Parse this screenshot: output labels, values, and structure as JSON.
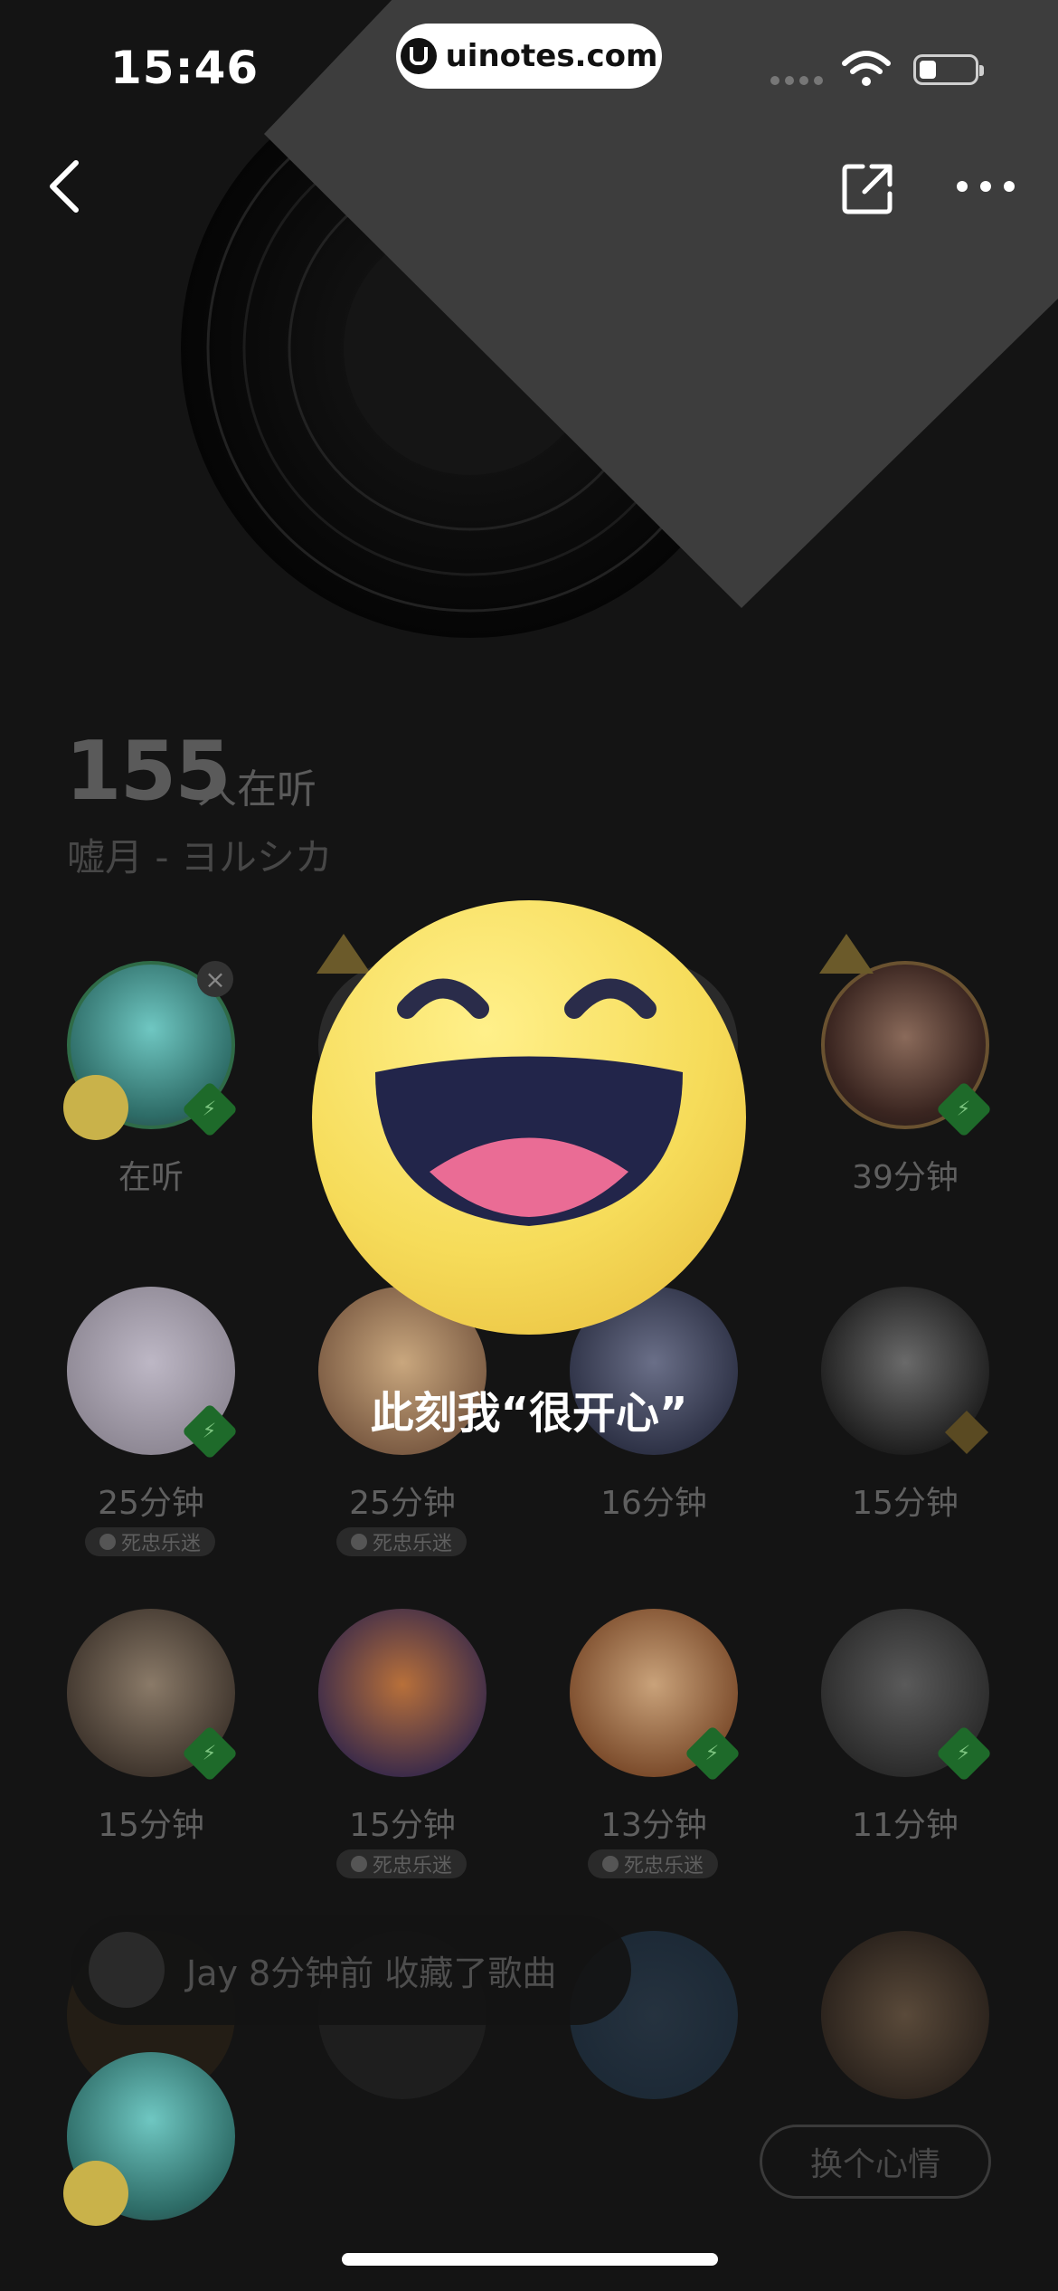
{
  "status_bar": {
    "time": "15:46",
    "url": "uinotes.com"
  },
  "header": {
    "listener_count": "155",
    "listener_unit": "人在听",
    "song_line": "嘘月 - ヨルシカ"
  },
  "grid": {
    "rows": [
      {
        "cells": [
          {
            "label": "在听",
            "badge": ""
          },
          {
            "label": "",
            "badge": ""
          },
          {
            "label": "",
            "badge": ""
          },
          {
            "label": "39分钟",
            "badge": ""
          }
        ]
      },
      {
        "cells": [
          {
            "label": "25分钟",
            "badge": "死忠乐迷"
          },
          {
            "label": "25分钟",
            "badge": "死忠乐迷"
          },
          {
            "label": "16分钟",
            "badge": ""
          },
          {
            "label": "15分钟",
            "badge": ""
          }
        ]
      },
      {
        "cells": [
          {
            "label": "15分钟",
            "badge": ""
          },
          {
            "label": "15分钟",
            "badge": "死忠乐迷"
          },
          {
            "label": "13分钟",
            "badge": "死忠乐迷"
          },
          {
            "label": "11分钟",
            "badge": ""
          }
        ]
      }
    ]
  },
  "notification": {
    "text": "Jay 8分钟前 收藏了歌曲"
  },
  "overlay": {
    "caption": "此刻我“很开心”"
  },
  "mood_button": {
    "label": "换个心情"
  },
  "colors": {
    "background": "#141414",
    "emoji_yellow": "#f6dc5a",
    "bolt_green": "#1e6a2a"
  }
}
